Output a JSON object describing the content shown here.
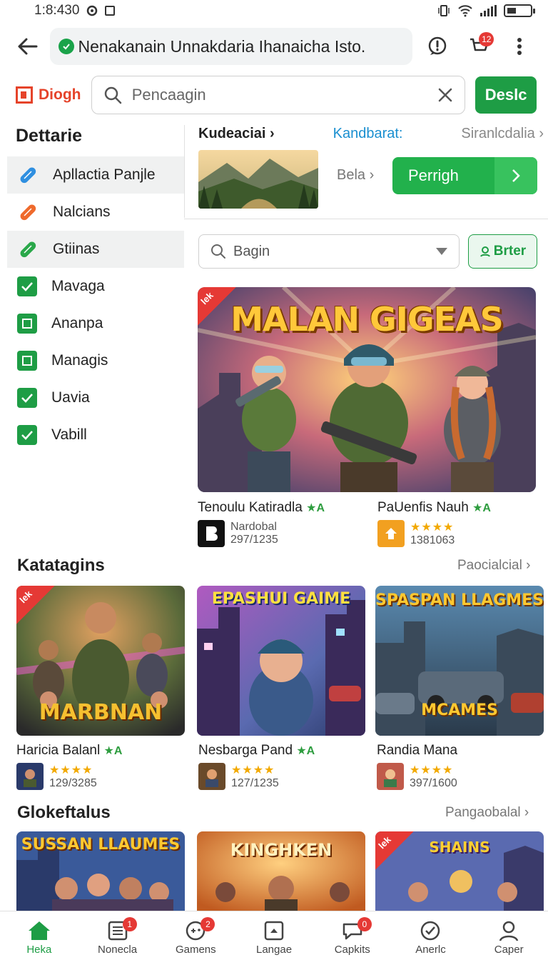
{
  "status_bar": {
    "time": "1:8:430"
  },
  "address_bar": {
    "url": "Nenakanain Unnakdaria Ihanaicha Isto.",
    "cart_badge": "12"
  },
  "search_row": {
    "logo_text": "Diogh",
    "placeholder": "Pencaagin",
    "button_label": "Deslc"
  },
  "sidebar": {
    "title": "Dettarie",
    "items": [
      {
        "label": "Apllactia Panjle",
        "icon": "pill-blue-icon",
        "selected": true
      },
      {
        "label": "Nalcians",
        "icon": "pill-orange-icon",
        "selected": false
      },
      {
        "label": "Gtiinas",
        "icon": "pill-green-icon",
        "selected": true
      },
      {
        "label": "Mavaga",
        "icon": "check-icon",
        "selected": false
      },
      {
        "label": "Ananpa",
        "icon": "box-icon",
        "selected": false
      },
      {
        "label": "Managis",
        "icon": "box-icon",
        "selected": false
      },
      {
        "label": "Uavia",
        "icon": "check-icon",
        "selected": false
      },
      {
        "label": "Vabill",
        "icon": "check-icon",
        "selected": false
      }
    ]
  },
  "top_panel": {
    "header_left": "Kudeaciai",
    "header_mid": "Kandbarat:",
    "header_right": "Siranlcdalia",
    "bela_label": "Bela",
    "cta_label": "Perrigh",
    "filter_value": "Bagin",
    "filter_button": "Brter"
  },
  "hero": {
    "banner_title": "MALAN GIGEAS",
    "corner_tag": "lek",
    "apps": [
      {
        "name": "Tenoulu Katiradla",
        "rating_tag": "★A",
        "developer": "Nardobal",
        "count": "297/1235"
      },
      {
        "name": "PaUenfis Nauh",
        "rating_tag": "★A",
        "stars": "★★★★",
        "count": "1381063"
      }
    ]
  },
  "section1": {
    "title": "Katatagins",
    "more": "Paocialcial",
    "cards": [
      {
        "banner": "MARBNAN",
        "tag": "lek",
        "name": "Haricia Balanl",
        "rating_tag": "★A",
        "stars": "★★★★",
        "count": "129/3285"
      },
      {
        "banner": "EPASHUI GAIME",
        "name": "Nesbarga Pand",
        "rating_tag": "★A",
        "stars": "★★★★",
        "count": "127/1235"
      },
      {
        "banner": "SPASPAN LLAGMES",
        "banner2": "MCAMES",
        "name": "Randia Mana",
        "stars": "★★★★",
        "count": "397/1600"
      }
    ]
  },
  "section2": {
    "title": "Glokeftalus",
    "more": "Pangaobalal",
    "cards": [
      {
        "banner": "SUSSAN LLAUMES"
      },
      {
        "banner": "KINGHKEN"
      },
      {
        "banner": "SHAINS",
        "tag": "lek"
      }
    ]
  },
  "bottom_nav": {
    "items": [
      {
        "label": "Heka",
        "icon": "home-icon",
        "active": true,
        "badge": ""
      },
      {
        "label": "Nonecla",
        "icon": "list-icon",
        "active": false,
        "badge": "1"
      },
      {
        "label": "Gamens",
        "icon": "gamepad-icon",
        "active": false,
        "badge": "2"
      },
      {
        "label": "Langae",
        "icon": "bag-icon",
        "active": false,
        "badge": ""
      },
      {
        "label": "Capkits",
        "icon": "chat-icon",
        "active": false,
        "badge": "0"
      },
      {
        "label": "Anerlc",
        "icon": "check-circle-icon",
        "active": false,
        "badge": ""
      },
      {
        "label": "Caper",
        "icon": "person-icon",
        "active": false,
        "badge": ""
      }
    ]
  },
  "colors": {
    "accent": "#1e9d45",
    "link": "#1a8fd0",
    "badge": "#e53935",
    "logo": "#e5432a"
  }
}
